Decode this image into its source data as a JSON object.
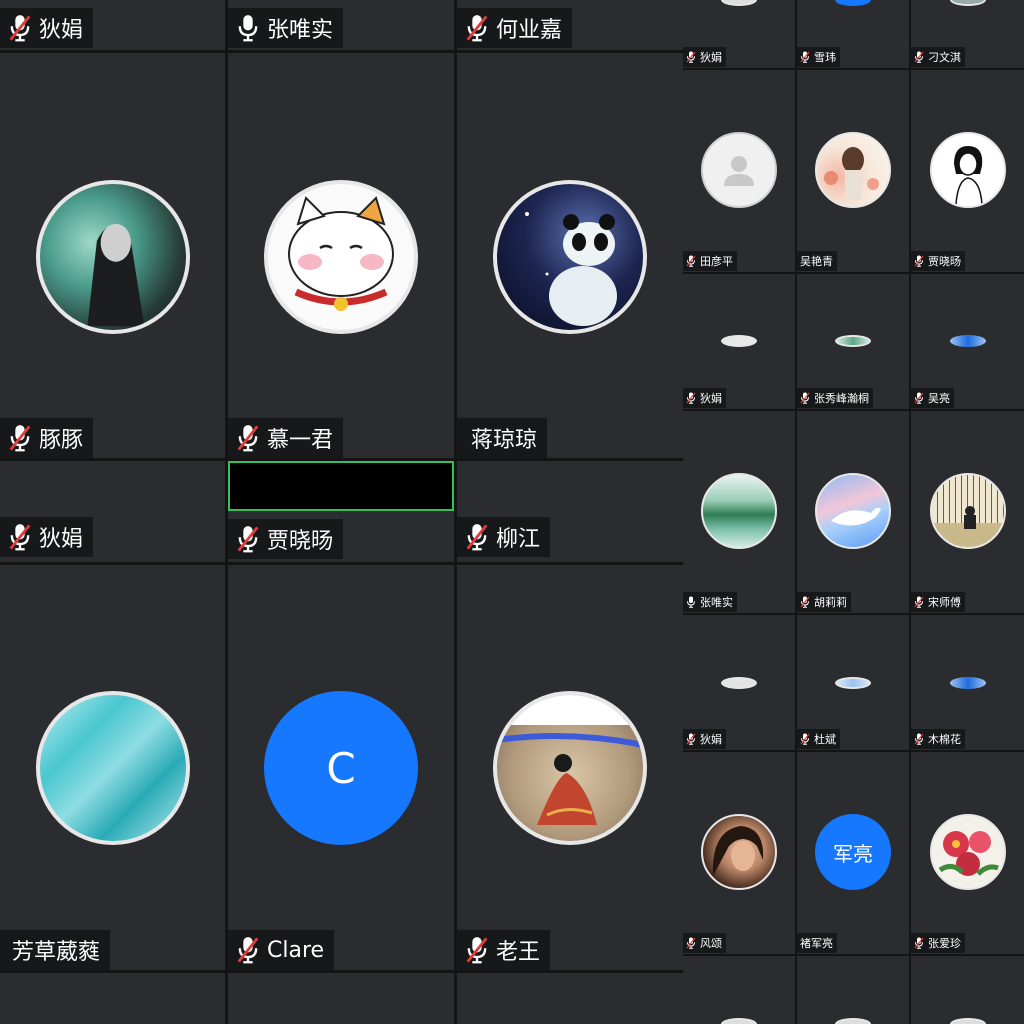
{
  "tiles": [
    {
      "name": "狄娟",
      "muted": true
    },
    {
      "name": "张唯实",
      "muted": false
    },
    {
      "name": "何业嘉",
      "muted": true
    },
    {
      "name": "豚豚",
      "muted": true
    },
    {
      "name": "慕一君",
      "muted": true
    },
    {
      "name": "蒋琼琼",
      "muted": false
    },
    {
      "name": "狄娟",
      "muted": true
    },
    {
      "name": "贾晓旸",
      "muted": true
    },
    {
      "name": "柳江",
      "muted": true
    },
    {
      "name": "芳草葳蕤",
      "muted": false
    },
    {
      "name": "Clare",
      "muted": true,
      "avatar_letter": "C"
    },
    {
      "name": "老王",
      "muted": true
    },
    {
      "name": "狄娟",
      "muted": true
    },
    {
      "name": "雪玮",
      "muted": true
    },
    {
      "name": "刁文淇",
      "muted": true
    },
    {
      "name": "田彦平",
      "muted": true
    },
    {
      "name": "吴艳青",
      "muted": false
    },
    {
      "name": "贾晓旸",
      "muted": true
    },
    {
      "name": "狄娟",
      "muted": true
    },
    {
      "name": "张秀峰瀚桐",
      "muted": true
    },
    {
      "name": "吴亮",
      "muted": true
    },
    {
      "name": "张唯实",
      "muted": false
    },
    {
      "name": "胡莉莉",
      "muted": true
    },
    {
      "name": "宋师傅",
      "muted": true
    },
    {
      "name": "狄娟",
      "muted": true
    },
    {
      "name": "杜斌",
      "muted": true
    },
    {
      "name": "木棉花",
      "muted": true
    },
    {
      "name": "风颂",
      "muted": true
    },
    {
      "name": "褚军亮",
      "muted": false,
      "avatar_letter": "军亮"
    },
    {
      "name": "张爱珍",
      "muted": true
    }
  ],
  "colors": {
    "tile_bg": "#2b2c30",
    "divider": "#141414",
    "muted_slash": "#e23b3b",
    "accent_blue": "#1677ff",
    "active_border": "#35c05a"
  },
  "icons": {
    "mic": "microphone-icon",
    "muted_mic": "muted-microphone-icon",
    "default_avatar": "user-silhouette-icon"
  }
}
